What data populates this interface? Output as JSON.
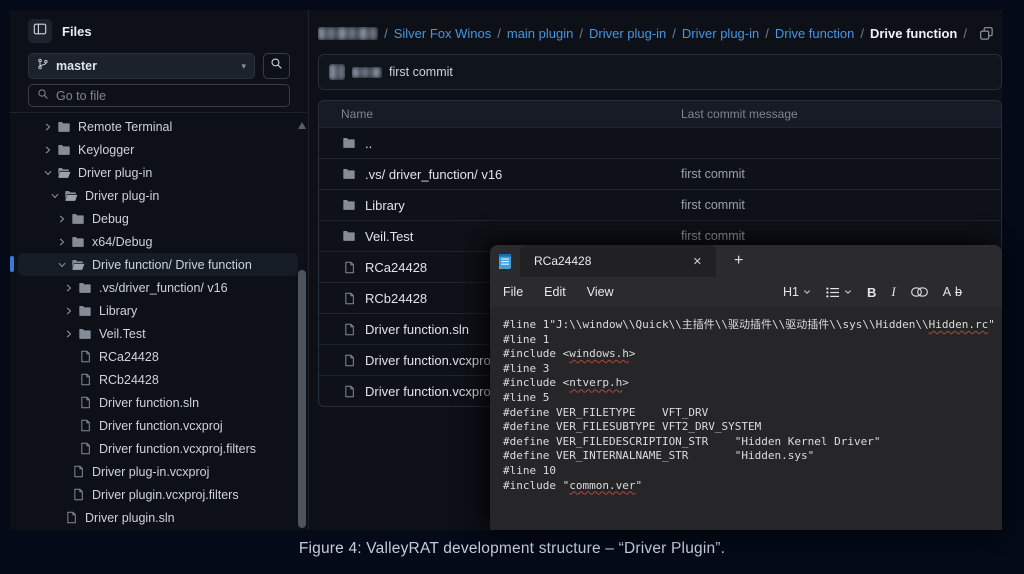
{
  "colors": {
    "accent_blue": "#3a7bd5",
    "link_blue": "#4795e0",
    "panel_bg": "#0d1017",
    "page_bg": "#050a18",
    "editor_bg": "#262628",
    "squiggle_red": "#b5443c"
  },
  "sidebar": {
    "title": "Files",
    "branch": {
      "name": "master"
    },
    "search_placeholder": "Go to file",
    "tree": [
      {
        "label": "Remote Terminal",
        "level": 0,
        "kind": "folder",
        "expanded": false
      },
      {
        "label": "Keylogger",
        "level": 0,
        "kind": "folder",
        "expanded": false
      },
      {
        "label": "Driver plug-in",
        "level": 0,
        "kind": "folder",
        "expanded": true
      },
      {
        "label": "Driver plug-in",
        "level": 1,
        "kind": "folder",
        "expanded": true
      },
      {
        "label": "Debug",
        "level": 2,
        "kind": "folder",
        "expanded": false
      },
      {
        "label": "x64/Debug",
        "level": 2,
        "kind": "folder",
        "expanded": false
      },
      {
        "label": "Drive function/ Drive function",
        "level": 2,
        "kind": "folder",
        "expanded": true,
        "selected": true
      },
      {
        "label": ".vs/driver_function/ v16",
        "level": 3,
        "kind": "folder",
        "expanded": false
      },
      {
        "label": "Library",
        "level": 3,
        "kind": "folder",
        "expanded": false
      },
      {
        "label": "Veil.Test",
        "level": 3,
        "kind": "folder",
        "expanded": false
      },
      {
        "label": "RCa24428",
        "level": 3,
        "kind": "file"
      },
      {
        "label": "RCb24428",
        "level": 3,
        "kind": "file"
      },
      {
        "label": "Driver function.sln",
        "level": 3,
        "kind": "file"
      },
      {
        "label": "Driver function.vcxproj",
        "level": 3,
        "kind": "file"
      },
      {
        "label": "Driver function.vcxproj.filters",
        "level": 3,
        "kind": "file"
      },
      {
        "label": "Driver plug-in.vcxproj",
        "level": 2,
        "kind": "file"
      },
      {
        "label": "Driver plugin.vcxproj.filters",
        "level": 2,
        "kind": "file"
      },
      {
        "label": "Driver plugin.sln",
        "level": 1,
        "kind": "file"
      }
    ]
  },
  "breadcrumb": {
    "items": [
      {
        "redacted": true
      },
      {
        "label": "Silver Fox Winos",
        "link": true
      },
      {
        "label": "main plugin",
        "link": true
      },
      {
        "label": "Driver plug-in",
        "link": true
      },
      {
        "label": "Driver plug-in",
        "link": true
      },
      {
        "label": "Drive function",
        "link": true
      },
      {
        "label": "Drive function",
        "current": true
      }
    ]
  },
  "commit_bar": {
    "author_redacted": true,
    "message": "first commit"
  },
  "file_table": {
    "columns": [
      "Name",
      "Last commit message"
    ],
    "rows": [
      {
        "name": "..",
        "kind": "folder",
        "commit": ""
      },
      {
        "name": ".vs/ driver_function/ v16",
        "kind": "folder",
        "commit": "first commit"
      },
      {
        "name": "Library",
        "kind": "folder",
        "commit": "first commit"
      },
      {
        "name": "Veil.Test",
        "kind": "folder",
        "commit": "first commit"
      },
      {
        "name": "RCa24428",
        "kind": "file",
        "commit": ""
      },
      {
        "name": "RCb24428",
        "kind": "file",
        "commit": ""
      },
      {
        "name": "Driver function.sln",
        "kind": "file",
        "commit": ""
      },
      {
        "name": "Driver function.vcxproj",
        "kind": "file",
        "commit": ""
      },
      {
        "name": "Driver function.vcxproj.filters",
        "kind": "file",
        "commit": ""
      }
    ]
  },
  "editor": {
    "tab_title": "RCa24428",
    "menus": [
      "File",
      "Edit",
      "View"
    ],
    "toolbar": {
      "heading": "H1",
      "bold": "B",
      "italic": "I",
      "clear_format_a": "A",
      "clear_format_b": "b"
    },
    "code_lines": [
      {
        "segments": [
          {
            "t": "#line 1\"J:\\\\window\\\\Quick\\\\主插件\\\\驱动插件\\\\驱动插件\\\\sys\\\\Hidden\\\\"
          },
          {
            "t": "Hidden.rc",
            "sq": true
          },
          {
            "t": "\""
          }
        ]
      },
      {
        "segments": [
          {
            "t": "#line 1"
          }
        ]
      },
      {
        "segments": [
          {
            "t": "#include <"
          },
          {
            "t": "windows.h",
            "sq": true
          },
          {
            "t": ">"
          }
        ]
      },
      {
        "segments": [
          {
            "t": "#line 3"
          }
        ]
      },
      {
        "segments": [
          {
            "t": "#include <"
          },
          {
            "t": "ntverp.h",
            "sq": true
          },
          {
            "t": ">"
          }
        ]
      },
      {
        "segments": [
          {
            "t": "#line 5"
          }
        ]
      },
      {
        "segments": [
          {
            "t": "#define VER_FILETYPE    VFT_DRV"
          }
        ]
      },
      {
        "segments": [
          {
            "t": "#define VER_FILESUBTYPE VFT2_DRV_SYSTEM"
          }
        ]
      },
      {
        "segments": [
          {
            "t": "#define VER_FILEDESCRIPTION_STR    \"Hidden Kernel Driver\""
          }
        ]
      },
      {
        "segments": [
          {
            "t": "#define VER_INTERNALNAME_STR       \"Hidden.sys\""
          }
        ]
      },
      {
        "segments": [
          {
            "t": "#line 10"
          }
        ]
      },
      {
        "segments": [
          {
            "t": "#include \""
          },
          {
            "t": "common.ver",
            "sq": true
          },
          {
            "t": "\""
          }
        ]
      }
    ]
  },
  "caption": "Figure 4: ValleyRAT development structure – “Driver Plugin”."
}
